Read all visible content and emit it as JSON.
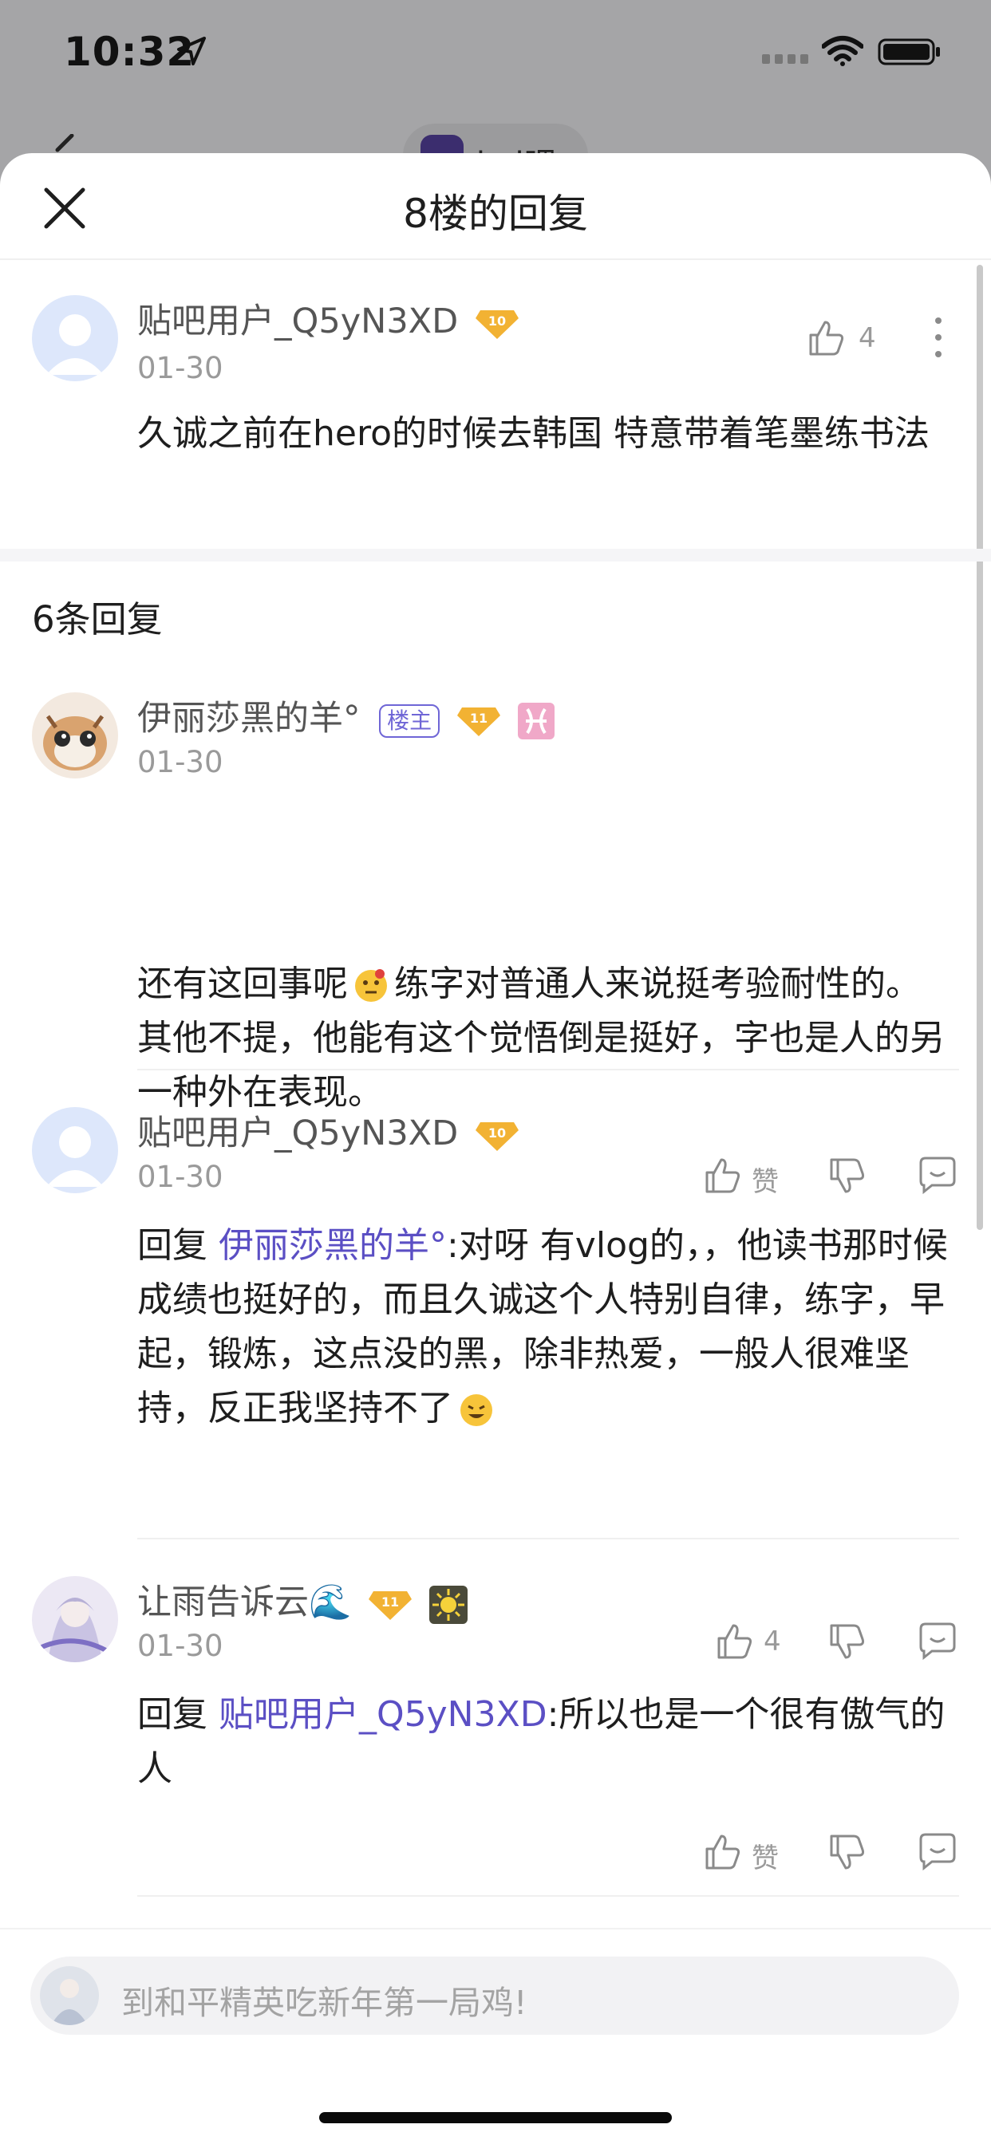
{
  "status_bar": {
    "time": "10:32"
  },
  "background_header": {
    "forum_name": "kpl吧"
  },
  "sheet": {
    "title": "8楼的回复"
  },
  "main_post": {
    "username": "贴吧用户_Q5yN3XD",
    "level": "10",
    "date": "01-30",
    "like_count": "4",
    "content": "久诚之前在hero的时候去韩国 特意带着笔墨练书法"
  },
  "reply_count_label": "6条回复",
  "replies": [
    {
      "username": "伊丽莎黑的羊°",
      "tag": "楼主",
      "level": "11",
      "date": "01-30",
      "content_before": "还有这回事呢",
      "content_after": "练字对普通人来说挺考验耐性的。其他不提，他能有这个觉悟倒是挺好，字也是人的另一种外在表现。",
      "like_label": "赞"
    },
    {
      "username": "贴吧用户_Q5yN3XD",
      "level": "10",
      "date": "01-30",
      "reply_prefix": "回复",
      "mention": "伊丽莎黑的羊°",
      "content": ":对呀 有vlog的，，他读书那时候成绩也挺好的，而且久诚这个人特别自律，练字，早起，锻炼，这点没的黑，除非热爱，一般人很难坚持，反正我坚持不了",
      "like_label": "4"
    },
    {
      "username": "让雨告诉云🌊",
      "level": "11",
      "date": "01-30",
      "reply_prefix": "回复",
      "mention": "贴吧用户_Q5yN3XD",
      "content": ":所以也是一个很有傲气的人",
      "like_label": "赞"
    }
  ],
  "input": {
    "placeholder": "到和平精英吃新年第一局鸡!"
  },
  "colors": {
    "accent_purple": "#5b4fc4",
    "level_gold": "#f2b233",
    "sheet_bg": "#ffffff"
  }
}
